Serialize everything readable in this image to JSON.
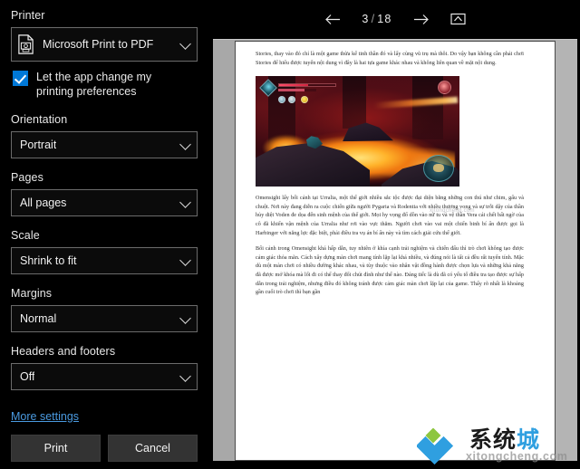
{
  "settings": {
    "printer": {
      "label": "Printer",
      "value": "Microsoft Print to PDF",
      "icon": "pdf-printer-icon"
    },
    "app_preferences": {
      "label": "Let the app change my printing preferences",
      "checked": true
    },
    "orientation": {
      "label": "Orientation",
      "value": "Portrait"
    },
    "pages": {
      "label": "Pages",
      "value": "All pages"
    },
    "scale": {
      "label": "Scale",
      "value": "Shrink to fit"
    },
    "margins": {
      "label": "Margins",
      "value": "Normal"
    },
    "headers_footers": {
      "label": "Headers and footers",
      "value": "Off"
    },
    "more_settings": "More settings",
    "buttons": {
      "print": "Print",
      "cancel": "Cancel"
    },
    "accent_color": "#0078d7",
    "link_color": "#4a9ae0"
  },
  "preview": {
    "toolbar": {
      "prev_icon": "arrow-left-icon",
      "next_icon": "arrow-right-icon",
      "fit_page_icon": "fit-to-page-icon",
      "current_page": "3",
      "separator": "/",
      "total_pages": "18"
    },
    "document": {
      "paragraphs": [
        "Stories, thay vào đó chỉ là một game thừa kế tinh thần đó và lấy cùng vũ trụ mà thôi. Do vậy bạn không cần phải chơi Stories để hiểu được tuyến nội dung vì đây là hai tựa game khác nhau và không liên quan về mặt nội dung.",
        "Omensight lấy bối cảnh tại Urralia, một thế giới nhiều sắc tộc được đại diện bằng những con thú như chim, gấu và chuột. Nơi này đang diễn ra cuộc chiến giữa người Pygaria và Rodentia với nhiều thương vong và sự trỗi dậy của thần hủy diệt Voden đe dọa đến sinh mệnh của thế giới. Mọi hy vọng đổ dồn vào nữ tu và vệ thần Vera cái chết bất ngờ của cô đã khiến vận mệnh của Urralia như rơi vào vực thẳm. Người chơi vào vai một chiến binh bí ẩn được gọi là Harbinger với năng lực đặc biệt, phải điều tra vụ án bí ẩn này và tìm cách giải cứu thế giới.",
        "Bối cảnh trong Omensight khá hấp dẫn, tuy nhiên ở khía cạnh trải nghiệm và chiến đấu thì trò chơi không tạo được cảm giác thỏa mãn. Cách xây dựng màn chơi mang tính lặp lại khá nhiều, và đúng nói là tất cả đều rất tuyến tính. Mặc dù một màn chơi có nhiều đường khác nhau, và tùy thuộc vào nhân vật đồng hành được chọn lựa và những khả năng đã được mở khóa mà lối đi có thể thay đổi chút đỉnh như thế nào. Đáng tiếc là dù đã có yếu tố điều tra tạo được sự hấp dẫn trong trải nghiệm, nhưng điều đó không tránh được cảm giác màn chơi lặp lại của game. Thấy rõ nhất là khoảng gần cuối trò chơi thì bạn gần"
      ],
      "image_alt": "omensight-gameplay-screenshot"
    },
    "watermarks": {
      "document_faint": "xitongcheng.com",
      "side_text": "xitongcheng.com",
      "brand_cn": "系统",
      "brand_cn_blue": "城",
      "brand_url": "xitongcheng.com"
    }
  }
}
